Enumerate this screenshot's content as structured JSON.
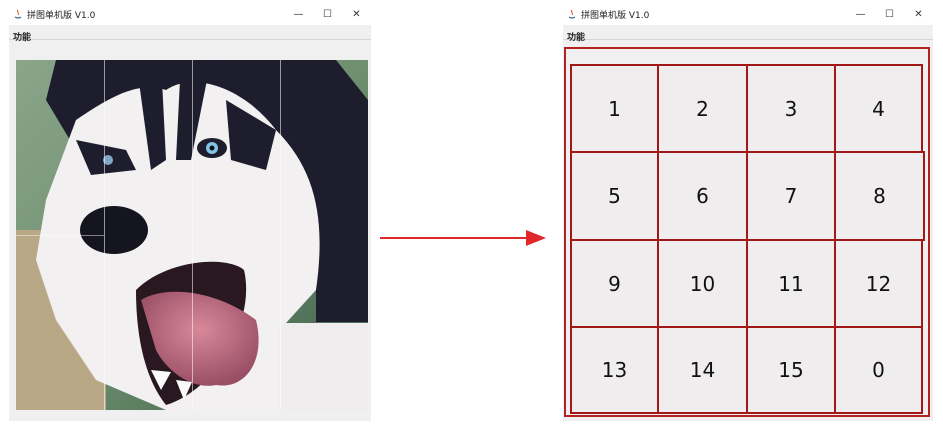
{
  "left_window": {
    "title": "拼图单机版 V1.0",
    "menu": "功能",
    "controls": {
      "minimize": "—",
      "maximize": "☐",
      "close": "✕"
    }
  },
  "right_window": {
    "title": "拼图单机版 V1.0",
    "menu": "功能",
    "controls": {
      "minimize": "—",
      "maximize": "☐",
      "close": "✕"
    },
    "tiles": [
      "1",
      "2",
      "3",
      "4",
      "5",
      "6",
      "7",
      "8",
      "9",
      "10",
      "11",
      "12",
      "13",
      "14",
      "15",
      "0"
    ]
  },
  "colors": {
    "accent": "#b22222",
    "arrow": "#e0282a",
    "window_bg": "#f0f0f0"
  }
}
